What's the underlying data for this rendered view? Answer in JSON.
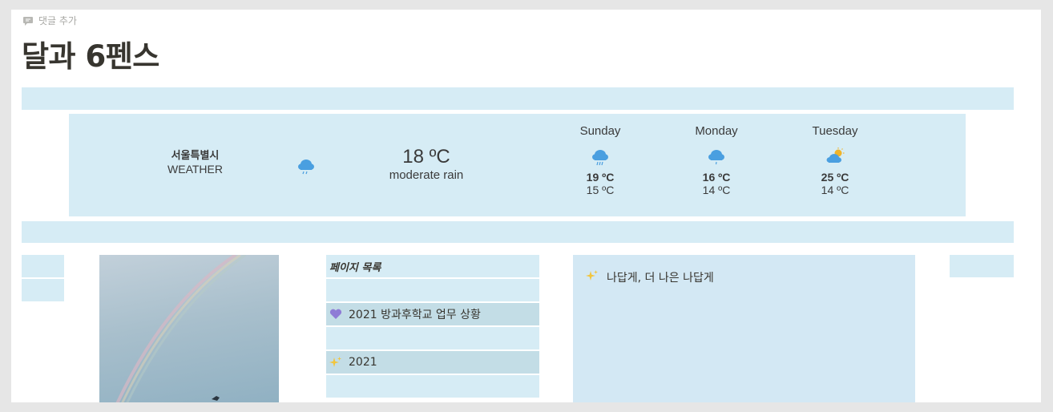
{
  "comment": {
    "label": "댓글 추가"
  },
  "page": {
    "title": "달과 6펜스"
  },
  "weather": {
    "city": "서울특별시",
    "city_sub": "WEATHER",
    "current": {
      "temp": "18 ºC",
      "description": "moderate rain",
      "icon": "rain-cloud-icon"
    },
    "forecast": [
      {
        "day": "Sunday",
        "high": "19 ºC",
        "low": "15 ºC",
        "icon": "rain-cloud-icon"
      },
      {
        "day": "Monday",
        "high": "16 ºC",
        "low": "14 ºC",
        "icon": "light-rain-cloud-icon"
      },
      {
        "day": "Tuesday",
        "high": "25 ºC",
        "low": "14 ºC",
        "icon": "partly-sunny-cloud-icon"
      }
    ]
  },
  "page_list": {
    "header": "페이지 목록",
    "items": [
      {
        "label": "2021 방과후학교 업무 상황",
        "icon": "purple-heart-icon"
      },
      {
        "label": "2021",
        "icon": "sparkles-icon"
      }
    ]
  },
  "callout": {
    "text": "나답게, 더 나은 나답게",
    "icon": "sparkles-icon"
  },
  "colors": {
    "band": "#d6ecf5",
    "accent_row": "#c3dde6",
    "callout": "#d3e8f4",
    "icon_blue": "#4a9fe0"
  }
}
